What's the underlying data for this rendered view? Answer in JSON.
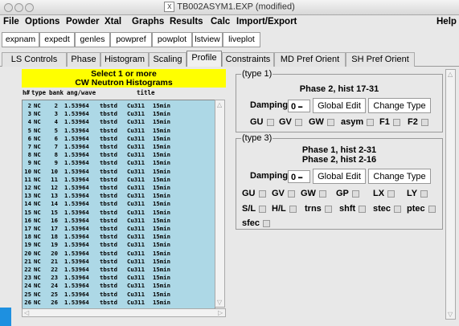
{
  "window": {
    "title": "TB002ASYM1.EXP (modified)"
  },
  "menu": [
    "File",
    "Options",
    "Powder",
    "Xtal",
    "Graphs",
    "Results",
    "Calc",
    "Import/Export"
  ],
  "help": "Help",
  "toolbar": [
    "expnam",
    "expedt",
    "genles",
    "powpref",
    "powplot",
    "lstview",
    "liveplot"
  ],
  "tabs": [
    "LS Controls",
    "Phase",
    "Histogram",
    "Scaling",
    "Profile",
    "Constraints",
    "MD Pref Orient",
    "SH Pref Orient"
  ],
  "active_tab": "Profile",
  "left": {
    "header_line1": "Select 1 or more",
    "header_line2": "CW Neutron Histograms",
    "columns": [
      "h#",
      "type",
      "bank",
      "ang/wave",
      "title"
    ],
    "rows": [
      [
        "2",
        "NC",
        "2",
        "1.53964",
        "tbstd",
        "Cu311",
        "15min"
      ],
      [
        "3",
        "NC",
        "3",
        "1.53964",
        "tbstd",
        "Cu311",
        "15min"
      ],
      [
        "4",
        "NC",
        "4",
        "1.53964",
        "tbstd",
        "Cu311",
        "15min"
      ],
      [
        "5",
        "NC",
        "5",
        "1.53964",
        "tbstd",
        "Cu311",
        "15min"
      ],
      [
        "6",
        "NC",
        "6",
        "1.53964",
        "tbstd",
        "Cu311",
        "15min"
      ],
      [
        "7",
        "NC",
        "7",
        "1.53964",
        "tbstd",
        "Cu311",
        "15min"
      ],
      [
        "8",
        "NC",
        "8",
        "1.53964",
        "tbstd",
        "Cu311",
        "15min"
      ],
      [
        "9",
        "NC",
        "9",
        "1.53964",
        "tbstd",
        "Cu311",
        "15min"
      ],
      [
        "10",
        "NC",
        "10",
        "1.53964",
        "tbstd",
        "Cu311",
        "15min"
      ],
      [
        "11",
        "NC",
        "11",
        "1.53964",
        "tbstd",
        "Cu311",
        "15min"
      ],
      [
        "12",
        "NC",
        "12",
        "1.53964",
        "tbstd",
        "Cu311",
        "15min"
      ],
      [
        "13",
        "NC",
        "13",
        "1.53964",
        "tbstd",
        "Cu311",
        "15min"
      ],
      [
        "14",
        "NC",
        "14",
        "1.53964",
        "tbstd",
        "Cu311",
        "15min"
      ],
      [
        "15",
        "NC",
        "15",
        "1.53964",
        "tbstd",
        "Cu311",
        "15min"
      ],
      [
        "16",
        "NC",
        "16",
        "1.53964",
        "tbstd",
        "Cu311",
        "15min"
      ],
      [
        "17",
        "NC",
        "17",
        "1.53964",
        "tbstd",
        "Cu311",
        "15min"
      ],
      [
        "18",
        "NC",
        "18",
        "1.53964",
        "tbstd",
        "Cu311",
        "15min"
      ],
      [
        "19",
        "NC",
        "19",
        "1.53964",
        "tbstd",
        "Cu311",
        "15min"
      ],
      [
        "20",
        "NC",
        "20",
        "1.53964",
        "tbstd",
        "Cu311",
        "15min"
      ],
      [
        "21",
        "NC",
        "21",
        "1.53964",
        "tbstd",
        "Cu311",
        "15min"
      ],
      [
        "22",
        "NC",
        "22",
        "1.53964",
        "tbstd",
        "Cu311",
        "15min"
      ],
      [
        "23",
        "NC",
        "23",
        "1.53964",
        "tbstd",
        "Cu311",
        "15min"
      ],
      [
        "24",
        "NC",
        "24",
        "1.53964",
        "tbstd",
        "Cu311",
        "15min"
      ],
      [
        "25",
        "NC",
        "25",
        "1.53964",
        "tbstd",
        "Cu311",
        "15min"
      ],
      [
        "26",
        "NC",
        "26",
        "1.53964",
        "tbstd",
        "Cu311",
        "15min"
      ]
    ]
  },
  "type1": {
    "label": "(type 1)",
    "info": "Phase 2, hist 17-31",
    "damping_label": "Damping",
    "damping_value": "0",
    "global_edit": "Global Edit",
    "change_type": "Change Type",
    "checks": [
      "GU",
      "GV",
      "GW",
      "asym",
      "F1",
      "F2"
    ]
  },
  "type3": {
    "label": "(type 3)",
    "info_line1": "Phase 1, hist 2-31",
    "info_line2": "Phase 2, hist 2-16",
    "damping_label": "Damping",
    "damping_value": "0",
    "global_edit": "Global Edit",
    "change_type": "Change Type",
    "checks_row1": [
      "GU",
      "GV",
      "GW",
      "GP",
      "LX",
      "LY"
    ],
    "checks_row2": [
      "S/L",
      "H/L",
      "trns",
      "shft",
      "stec",
      "ptec"
    ],
    "checks_row3": [
      "sfec"
    ]
  },
  "colors": {
    "header_bg": "#ffff00",
    "list_bg": "#add8e6",
    "accent": "#1e90e0"
  },
  "icons": [
    "close-icon",
    "minimize-icon",
    "zoom-icon",
    "x11-icon",
    "dropdown-icon",
    "scroll-up-icon",
    "scroll-down-icon",
    "scroll-left-icon",
    "scroll-right-icon"
  ]
}
